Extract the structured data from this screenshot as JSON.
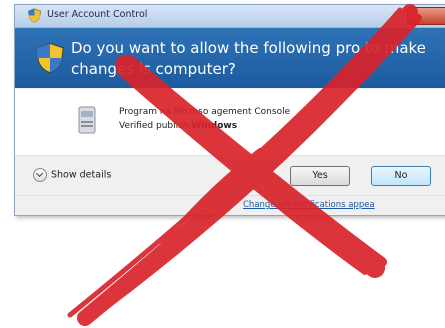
{
  "window": {
    "title": "User Account Control",
    "question_line1": "Do you want to allow the following pro   to make",
    "question_line2": "changes    is computer?",
    "program_name_label": "Program na",
    "program_name_value": "Microso      agement Console",
    "publisher_label": "Verified publish",
    "publisher_value": "Windows",
    "show_details": "Show details",
    "yes_label": "Yes",
    "no_label": "No",
    "change_link": "Change wh      notifications appea"
  },
  "icons": {
    "title_icon": "uac-shield-icon",
    "header_icon": "uac-shield-icon",
    "program_icon": "console-program-icon",
    "close_icon": "close-icon",
    "details_icon": "chevron-down-icon",
    "overlay": "red-x-mark-icon"
  },
  "colors": {
    "header_bg": "#2e73b6",
    "cross_red": "#d8232a",
    "link": "#1a5aa8"
  }
}
